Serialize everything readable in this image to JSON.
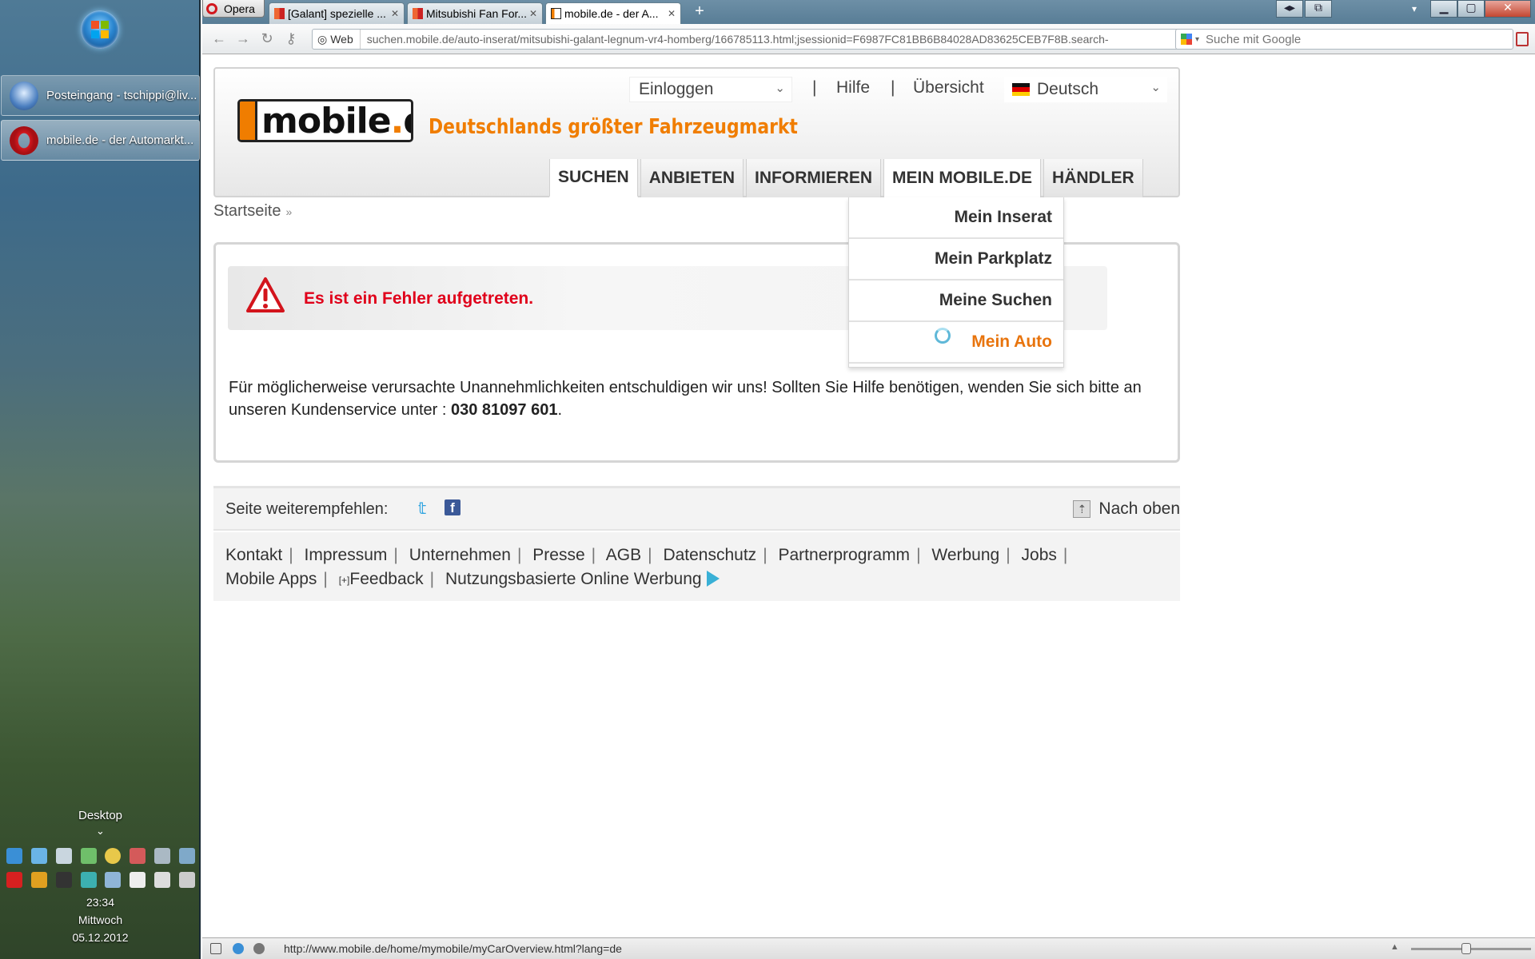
{
  "taskbar": {
    "items": [
      {
        "label": "Posteingang - tschippi@liv...",
        "icon": "thunderbird-icon"
      },
      {
        "label": "mobile.de - der Automarkt...",
        "icon": "opera-icon"
      }
    ],
    "desktop_label": "Desktop",
    "clock": {
      "time": "23:34",
      "day": "Mittwoch",
      "date": "05.12.2012"
    }
  },
  "browser": {
    "menu_label": "Opera",
    "tabs": [
      {
        "title": "[Galant] spezielle ..."
      },
      {
        "title": "Mitsubishi Fan For..."
      },
      {
        "title": "mobile.de - der A...",
        "active": true
      }
    ],
    "address": {
      "badge": "Web",
      "url": "suchen.mobile.de/auto-inserat/mitsubishi-galant-legnum-vr4-homberg/166785113.html;jsessionid=F6987FC81BB6B84028AD83625CEB7F8B.search-"
    },
    "search": {
      "placeholder": "Suche mit Google"
    },
    "status_url": "http://www.mobile.de/home/mymobile/myCarOverview.html?lang=de"
  },
  "site": {
    "login_label": "Einloggen",
    "help_label": "Hilfe",
    "overview_label": "Übersicht",
    "language_label": "Deutsch",
    "logo_text": "mobile",
    "logo_tld": "de",
    "tagline": "Deutschlands größter Fahrzeugmarkt",
    "nav": [
      {
        "label": "SUCHEN"
      },
      {
        "label": "ANBIETEN"
      },
      {
        "label": "INFORMIEREN"
      },
      {
        "label": "MEIN MOBILE.DE"
      },
      {
        "label": "HÄNDLER"
      }
    ],
    "dropdown": [
      {
        "label": "Mein Inserat"
      },
      {
        "label": "Mein Parkplatz"
      },
      {
        "label": "Meine Suchen"
      },
      {
        "label": "Mein Auto"
      }
    ],
    "breadcrumb": "Startseite",
    "error": {
      "title": "Es ist ein Fehler aufgetreten.",
      "message": "Für möglicherweise verursachte Unannehmlichkeiten entschuldigen wir uns! Sollten Sie Hilfe benötigen, wenden Sie sich bitte an unseren Kundenservice unter :",
      "phone": "030 81097 601",
      "end": "."
    },
    "footer": {
      "share_label": "Seite weiterempfehlen:",
      "to_top": "Nach oben",
      "links": [
        "Kontakt",
        "Impressum",
        "Unternehmen",
        "Presse",
        "AGB",
        "Datenschutz",
        "Partnerprogramm",
        "Werbung",
        "Jobs"
      ],
      "links2": [
        "Mobile Apps",
        "Feedback",
        "Nutzungsbasierte Online Werbung"
      ],
      "feedback_prefix": "[+]"
    }
  },
  "colors": {
    "brand_orange": "#f07d00",
    "error_red": "#e0001a",
    "hover_orange": "#e8740d"
  }
}
